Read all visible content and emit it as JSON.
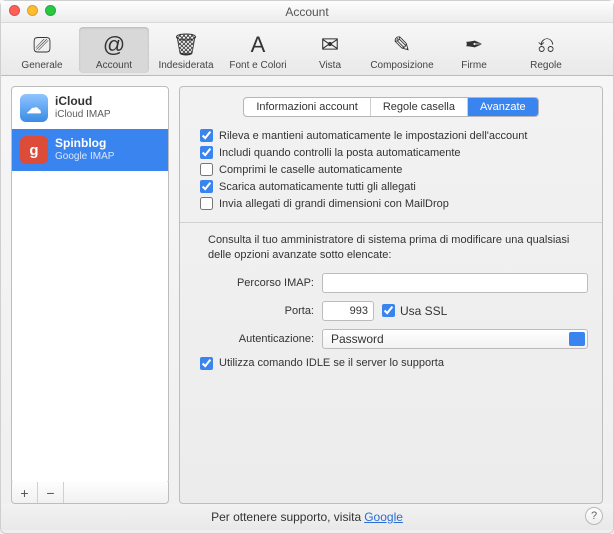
{
  "window": {
    "title": "Account"
  },
  "toolbar": [
    {
      "id": "general",
      "label": "Generale",
      "glyph": "⎚"
    },
    {
      "id": "account",
      "label": "Account",
      "glyph": "@",
      "selected": true
    },
    {
      "id": "junk",
      "label": "Indesiderata",
      "glyph": "🗑"
    },
    {
      "id": "fonts",
      "label": "Font e Colori",
      "glyph": "A"
    },
    {
      "id": "viewing",
      "label": "Vista",
      "glyph": "✉"
    },
    {
      "id": "compose",
      "label": "Composizione",
      "glyph": "✎"
    },
    {
      "id": "sign",
      "label": "Firme",
      "glyph": "✒"
    },
    {
      "id": "rules",
      "label": "Regole",
      "glyph": "⎌"
    }
  ],
  "sidebar": {
    "accounts": [
      {
        "name": "iCloud",
        "sub": "iCloud IMAP",
        "kind": "icloud",
        "glyph": "☁"
      },
      {
        "name": "Spinblog",
        "sub": "Google IMAP",
        "kind": "google",
        "glyph": "g",
        "selected": true
      }
    ],
    "add": "+",
    "remove": "−"
  },
  "tabs": {
    "items": [
      {
        "label": "Informazioni account"
      },
      {
        "label": "Regole casella"
      },
      {
        "label": "Avanzate",
        "active": true
      }
    ]
  },
  "checks": [
    {
      "label": "Rileva e mantieni automaticamente le impostazioni dell'account",
      "checked": true
    },
    {
      "label": "Includi quando controlli la posta automaticamente",
      "checked": true
    },
    {
      "label": "Comprimi le caselle automaticamente",
      "checked": false
    },
    {
      "label": "Scarica automaticamente tutti gli allegati",
      "checked": true
    },
    {
      "label": "Invia allegati di grandi dimensioni con MailDrop",
      "checked": false
    }
  ],
  "note": "Consulta il tuo amministratore di sistema prima di modificare una qualsiasi delle opzioni avanzate sotto elencate:",
  "form": {
    "path_label": "Percorso IMAP:",
    "path_value": "",
    "port_label": "Porta:",
    "port_value": "993",
    "ssl_label": "Usa SSL",
    "ssl_checked": true,
    "auth_label": "Autenticazione:",
    "auth_value": "Password"
  },
  "idle": {
    "label": "Utilizza comando IDLE se il server lo supporta",
    "checked": true
  },
  "footer": {
    "prefix": "Per ottenere supporto, visita ",
    "link": "Google",
    "help": "?"
  }
}
